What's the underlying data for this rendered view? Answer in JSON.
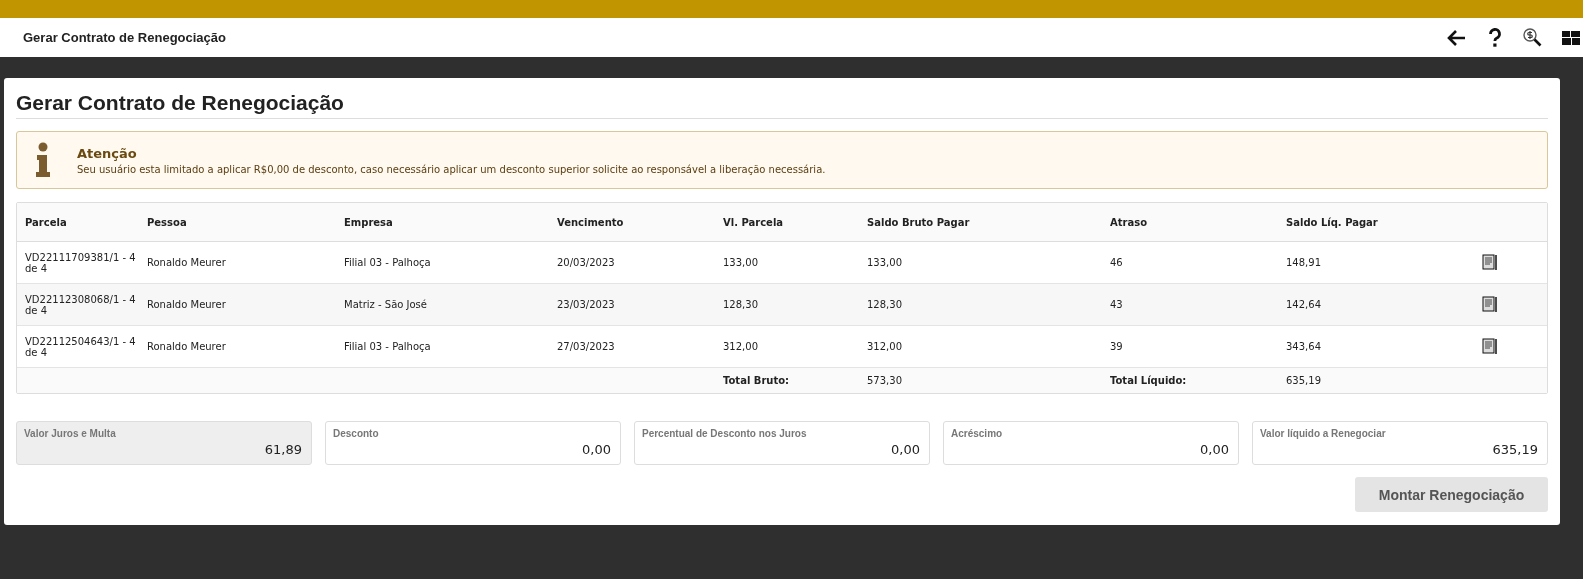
{
  "header": {
    "title": "Gerar Contrato de Renegociação"
  },
  "page": {
    "title": "Gerar Contrato de Renegociação"
  },
  "alert": {
    "title": "Atenção",
    "message": "Seu usuário esta limitado a aplicar R$0,00 de desconto, caso necessário aplicar um desconto superior solicite ao responsável a liberação necessária."
  },
  "table": {
    "columns": [
      "Parcela",
      "Pessoa",
      "Empresa",
      "Vencimento",
      "Vl. Parcela",
      "Saldo Bruto Pagar",
      "Atraso",
      "Saldo Líq. Pagar"
    ],
    "rows": [
      {
        "cells": [
          "VD22111709381/1 - 4 de 4",
          "Ronaldo Meurer",
          "Filial 03 - Palhoça",
          "20/03/2023",
          "133,00",
          "133,00",
          "46",
          "148,91"
        ]
      },
      {
        "cells": [
          "VD22112308068/1 - 4 de 4",
          "Ronaldo Meurer",
          "Matriz - São José",
          "23/03/2023",
          "128,30",
          "128,30",
          "43",
          "142,64"
        ]
      },
      {
        "cells": [
          "VD22112504643/1 - 4 de 4",
          "Ronaldo Meurer",
          "Filial 03 - Palhoça",
          "27/03/2023",
          "312,00",
          "312,00",
          "39",
          "343,64"
        ]
      }
    ],
    "totals": {
      "gross_label": "Total Bruto:",
      "gross": "573,30",
      "net_label": "Total Líquido:",
      "net": "635,19"
    }
  },
  "fields": [
    {
      "label": "Valor Juros e Multa",
      "value": "61,89",
      "disabled": true
    },
    {
      "label": "Desconto",
      "value": "0,00",
      "disabled": false
    },
    {
      "label": "Percentual de Desconto nos Juros",
      "value": "0,00",
      "disabled": false
    },
    {
      "label": "Acréscimo",
      "value": "0,00",
      "disabled": false
    },
    {
      "label": "Valor líquido a Renegociar",
      "value": "635,19",
      "disabled": false
    }
  ],
  "button": {
    "label": "Montar Renegociação",
    "disabled": true
  }
}
